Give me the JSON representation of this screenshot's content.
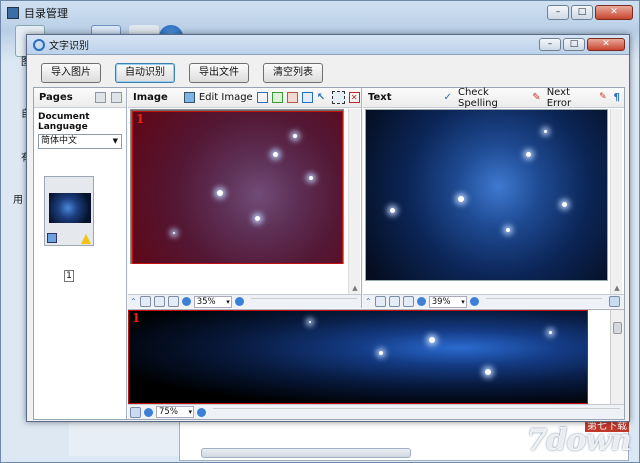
{
  "background_window": {
    "title": "目录管理",
    "side_labels": [
      "自",
      "有",
      "用"
    ],
    "toolbar_label": "图"
  },
  "watermark": {
    "text": "7down",
    "sub": "第七下载"
  },
  "dialog": {
    "title": "文字识别",
    "buttons": [
      "导入图片",
      "自动识别",
      "导出文件",
      "清空列表"
    ]
  },
  "pages": {
    "header": "Pages",
    "document_language_label": "Document Language",
    "language_value": "简体中文",
    "page_number": "1"
  },
  "image_pane": {
    "header": "Image",
    "edit_image_label": "Edit Image",
    "zone_number": "1",
    "zoom": "35%"
  },
  "text_pane": {
    "header": "Text",
    "check_spelling_label": "Check Spelling",
    "next_error_label": "Next Error",
    "zoom": "39%"
  },
  "bottom_pane": {
    "zone_number": "1",
    "zoom": "75%"
  },
  "colors": {
    "zone_border": "#c01010",
    "accent": "#3c7fd6"
  }
}
